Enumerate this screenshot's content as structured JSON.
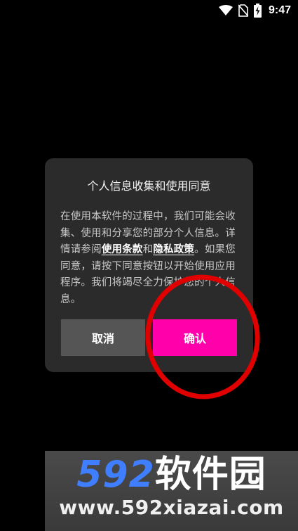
{
  "status_bar": {
    "time": "9:47",
    "icons": [
      "wifi-icon",
      "no-sim-icon",
      "battery-charging-icon"
    ]
  },
  "dialog": {
    "title": "个人信息收集和使用同意",
    "body_part1": "在使用本软件的过程中，我们可能会收集、使用和分享您的部分个人信息。详情请参阅",
    "terms_link": "使用条款",
    "conjunction": "和",
    "privacy_link": "隐私政策",
    "body_part2": "。如果您同意，请按下同意按钮以开始使用应用程序。我们将竭尽全力保护您的个人信息。",
    "cancel_label": "取消",
    "confirm_label": "确认"
  },
  "colors": {
    "background": "#000000",
    "dialog_bg": "#2b2b2b",
    "cancel_bg": "#555555",
    "confirm_bg": "#ff00aa",
    "annotation": "#e00000"
  },
  "watermark": {
    "logo_number": "592",
    "logo_text": "软件园",
    "url": "www.592xiazai.com"
  }
}
